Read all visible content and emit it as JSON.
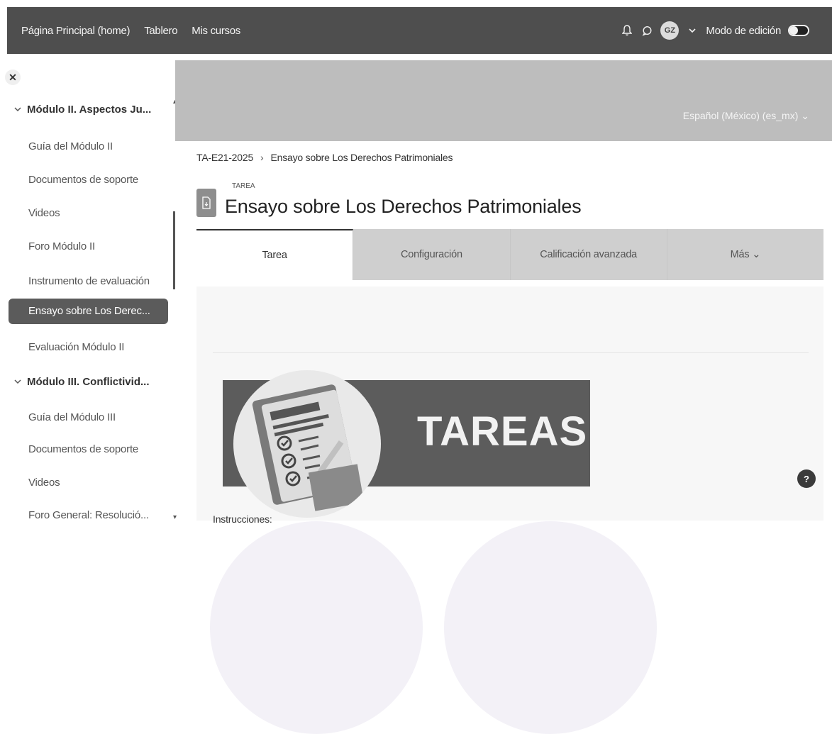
{
  "topbar": {
    "links": [
      "Página Principal (home)",
      "Tablero",
      "Mis cursos"
    ],
    "avatar_initials": "GZ",
    "edit_mode_label": "Modo de edición",
    "icons": [
      "bell-icon",
      "chat-icon",
      "chevron-down-icon"
    ]
  },
  "sidebar": {
    "section1": "Módulo II. Aspectos Ju...",
    "items1": [
      "Guía del Módulo II",
      "Documentos de soporte",
      "Videos",
      "Foro Módulo II",
      "Instrumento de evaluación"
    ],
    "active_item": "Ensayo sobre Los Derec...",
    "after_active": "Evaluación Módulo II",
    "section2": "Módulo III. Conflictivid...",
    "items2": [
      "Guía del Módulo III",
      "Documentos de soporte",
      "Videos",
      "Foro General: Resolució..."
    ]
  },
  "banner": {
    "language": "Español (México) (es_mx)"
  },
  "breadcrumb": {
    "course": "TA-E21-2025",
    "page": "Ensayo sobre Los Derechos Patrimoniales"
  },
  "activity": {
    "kicker": "TAREA",
    "title": "Ensayo sobre Los Derechos Patrimoniales"
  },
  "tabs": [
    "Tarea",
    "Configuración",
    "Calificación avanzada",
    "Más"
  ],
  "content": {
    "banner_text": "TAREAS",
    "instructions_label": "Instrucciones:"
  },
  "help": {
    "label": "?"
  }
}
